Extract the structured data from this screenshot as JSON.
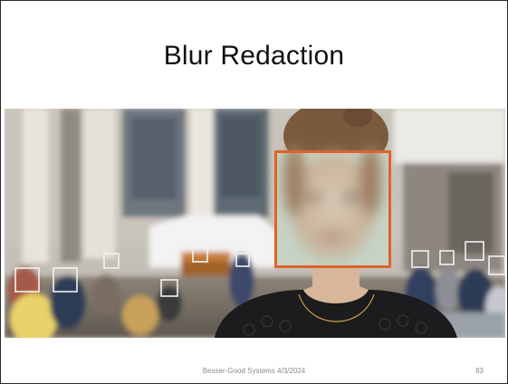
{
  "slide": {
    "title": "Blur Redaction",
    "footer": "Besser-Good Systems 4/3/2024",
    "page_number": "83"
  },
  "image": {
    "description_icon": "photo-blur-redaction",
    "highlight_color": "#e0622a",
    "background_box_color": "#f2f2f2"
  }
}
